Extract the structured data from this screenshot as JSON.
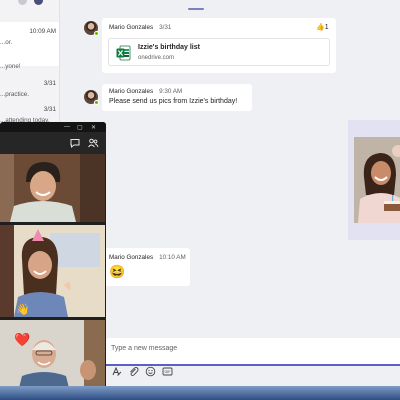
{
  "sidebar": {
    "items": [
      {
        "time": "10:09 AM",
        "preview": "...or."
      },
      {
        "time": "",
        "preview": "...yone!"
      },
      {
        "time": "3/31",
        "preview": "...practice."
      },
      {
        "time": "3/31",
        "preview": "...attending today."
      }
    ]
  },
  "messages": [
    {
      "sender": "Mario Gonzales",
      "time": "3/31",
      "reaction": {
        "emoji": "👍",
        "count": "1"
      },
      "file": {
        "title": "Izzie's birthday list",
        "host": "onedrive.com"
      }
    },
    {
      "sender": "Mario Gonzales",
      "time": "9:30 AM",
      "text": "Please send us pics from Izzie's birthday!"
    },
    {
      "sender": "Mario Gonzales",
      "time": "10:10 AM",
      "emoji": "😆"
    }
  ],
  "compose": {
    "placeholder": "Type a new message"
  },
  "call": {
    "tile_emojis": [
      "👋",
      "❤️"
    ]
  },
  "icons": {
    "sidebar": [
      "avatar-dot",
      "avatar-dot"
    ],
    "call_header": [
      "chat-icon",
      "participants-icon"
    ],
    "compose_tools": [
      "format-icon",
      "attach-icon",
      "emoji-icon",
      "gif-icon"
    ],
    "file": "excel-icon"
  },
  "colors": {
    "accent": "#5b5fc7",
    "presence": "#6bb700",
    "excel": "#217346",
    "photo_card": "#e3e2f3"
  }
}
